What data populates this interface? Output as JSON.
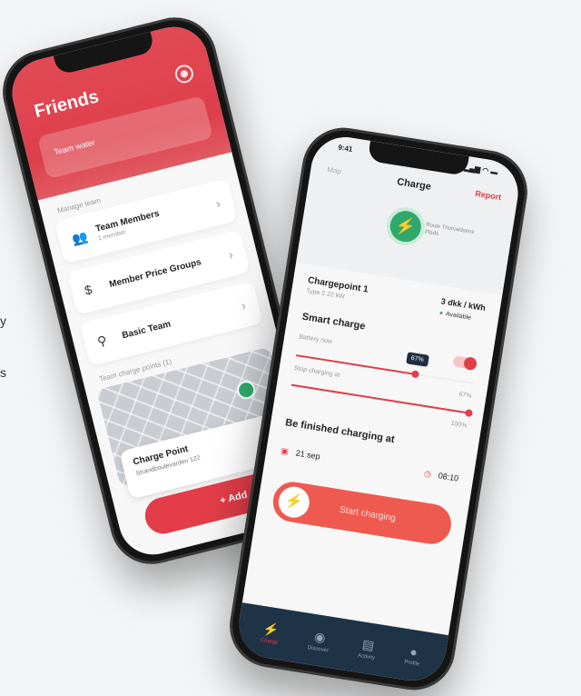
{
  "edge_text": [
    "y",
    "s"
  ],
  "friends": {
    "title": "Friends",
    "team_card": "Team water",
    "manage_label": "Manage team",
    "items": [
      {
        "label": "Team Members",
        "sub": "1 member",
        "icon": "users-icon",
        "glyph": "👥"
      },
      {
        "label": "Member Price Groups",
        "sub": "",
        "icon": "dollar-icon",
        "glyph": "$"
      },
      {
        "label": "Basic Team",
        "sub": "",
        "icon": "badge-icon",
        "glyph": "⚲"
      }
    ],
    "charge_points_label": "Team charge points (1)",
    "charge_point": {
      "title": "Charge Point",
      "address": "Strandboulevarden 122"
    },
    "add_button": "+ Add"
  },
  "charge": {
    "status_time": "9:41",
    "status_icons": "▂▄▆ ◠ ▬",
    "back": "Map",
    "title": "Charge",
    "report": "Report",
    "map_label": "Route Thorvaldsens Plads",
    "chargepoint": {
      "title": "Chargepoint 1",
      "sub": "Type 2 22 kW",
      "distance": "3 dkk / kWh",
      "status": "Available"
    },
    "smart_charge": "Smart charge",
    "battery_now": "Battery now",
    "battery_value": "67%",
    "battery_level": 0.67,
    "stop_label": "Stop charging at",
    "stop_value": "100%",
    "stop_level": 1.0,
    "finish_title": "Be finished charging at",
    "date": "21 sep",
    "time": "08:10",
    "start_button": "Start charging",
    "tabs": [
      "Charge",
      "Discover",
      "Activity",
      "Profile"
    ]
  },
  "colors": {
    "accent": "#e23d48",
    "green": "#2fa96b",
    "navy": "#1e3346"
  }
}
